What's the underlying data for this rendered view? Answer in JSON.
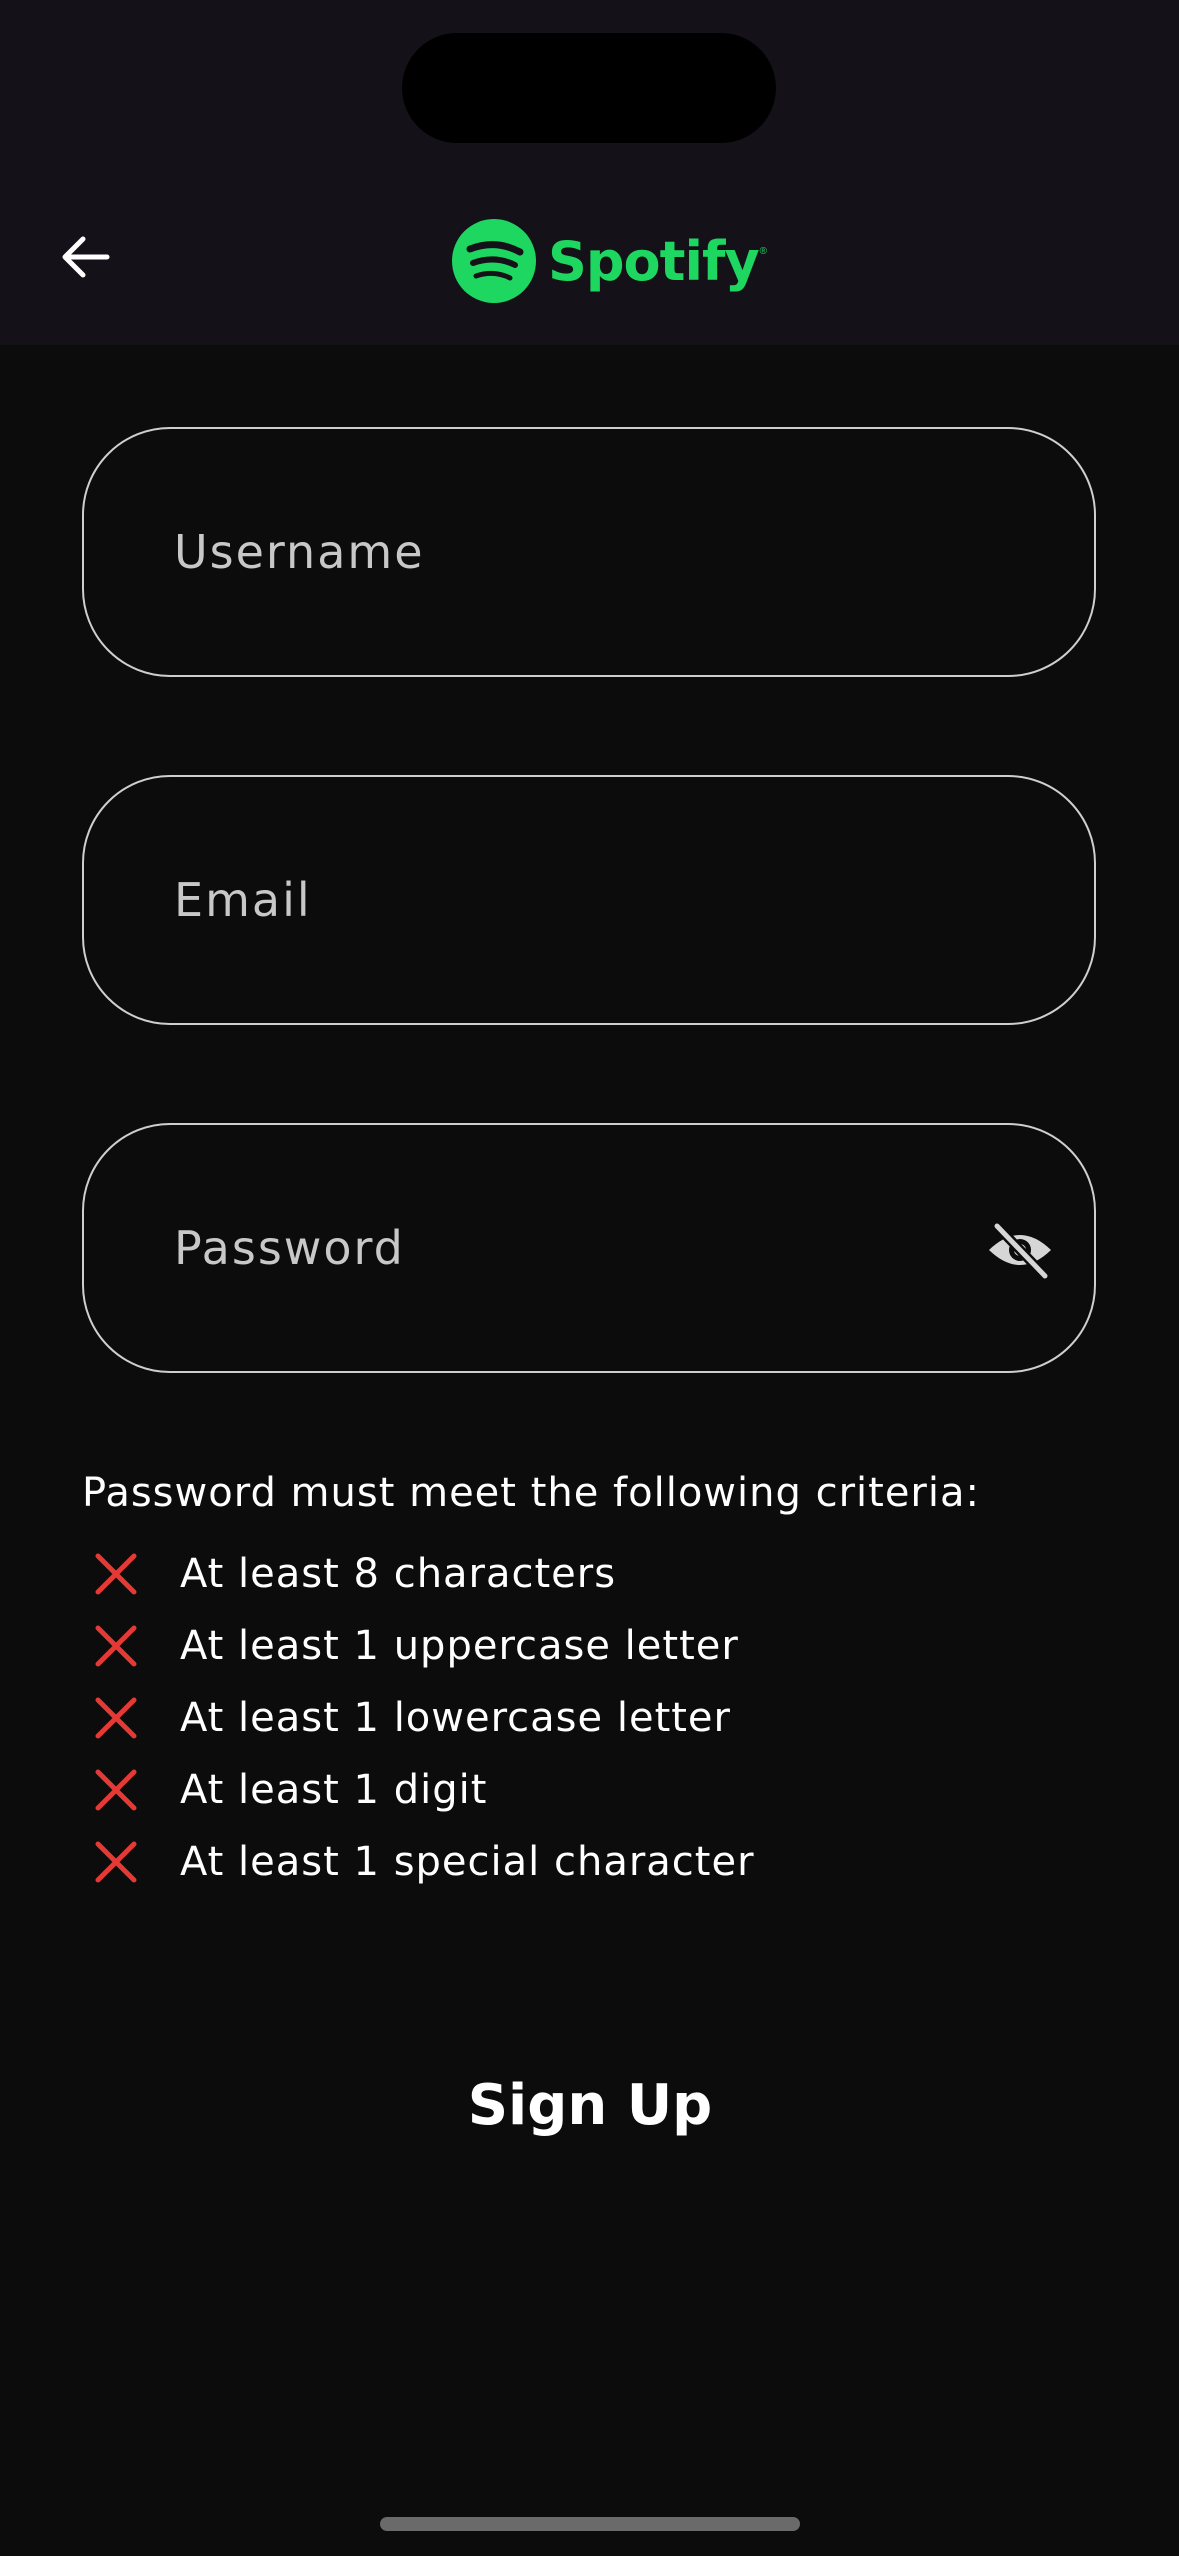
{
  "app": {
    "logo_text": "Spotify",
    "logo_reg": "®",
    "brand_color": "#1ed760"
  },
  "header": {
    "back_icon": "arrow-left-icon"
  },
  "form": {
    "username": {
      "value": "",
      "placeholder": "Username"
    },
    "email": {
      "value": "",
      "placeholder": "Email"
    },
    "password": {
      "value": "",
      "placeholder": "Password",
      "visibility_icon": "eye-off-icon"
    }
  },
  "criteria": {
    "title": "Password must meet the following criteria:",
    "fail_icon": "cross-icon",
    "fail_color": "#e53935",
    "items": [
      {
        "label": "At least 8 characters",
        "met": false
      },
      {
        "label": "At least 1 uppercase letter",
        "met": false
      },
      {
        "label": "At least 1 lowercase letter",
        "met": false
      },
      {
        "label": "At least 1 digit",
        "met": false
      },
      {
        "label": "At least 1 special character",
        "met": false
      }
    ]
  },
  "signup": {
    "label": "Sign Up"
  }
}
